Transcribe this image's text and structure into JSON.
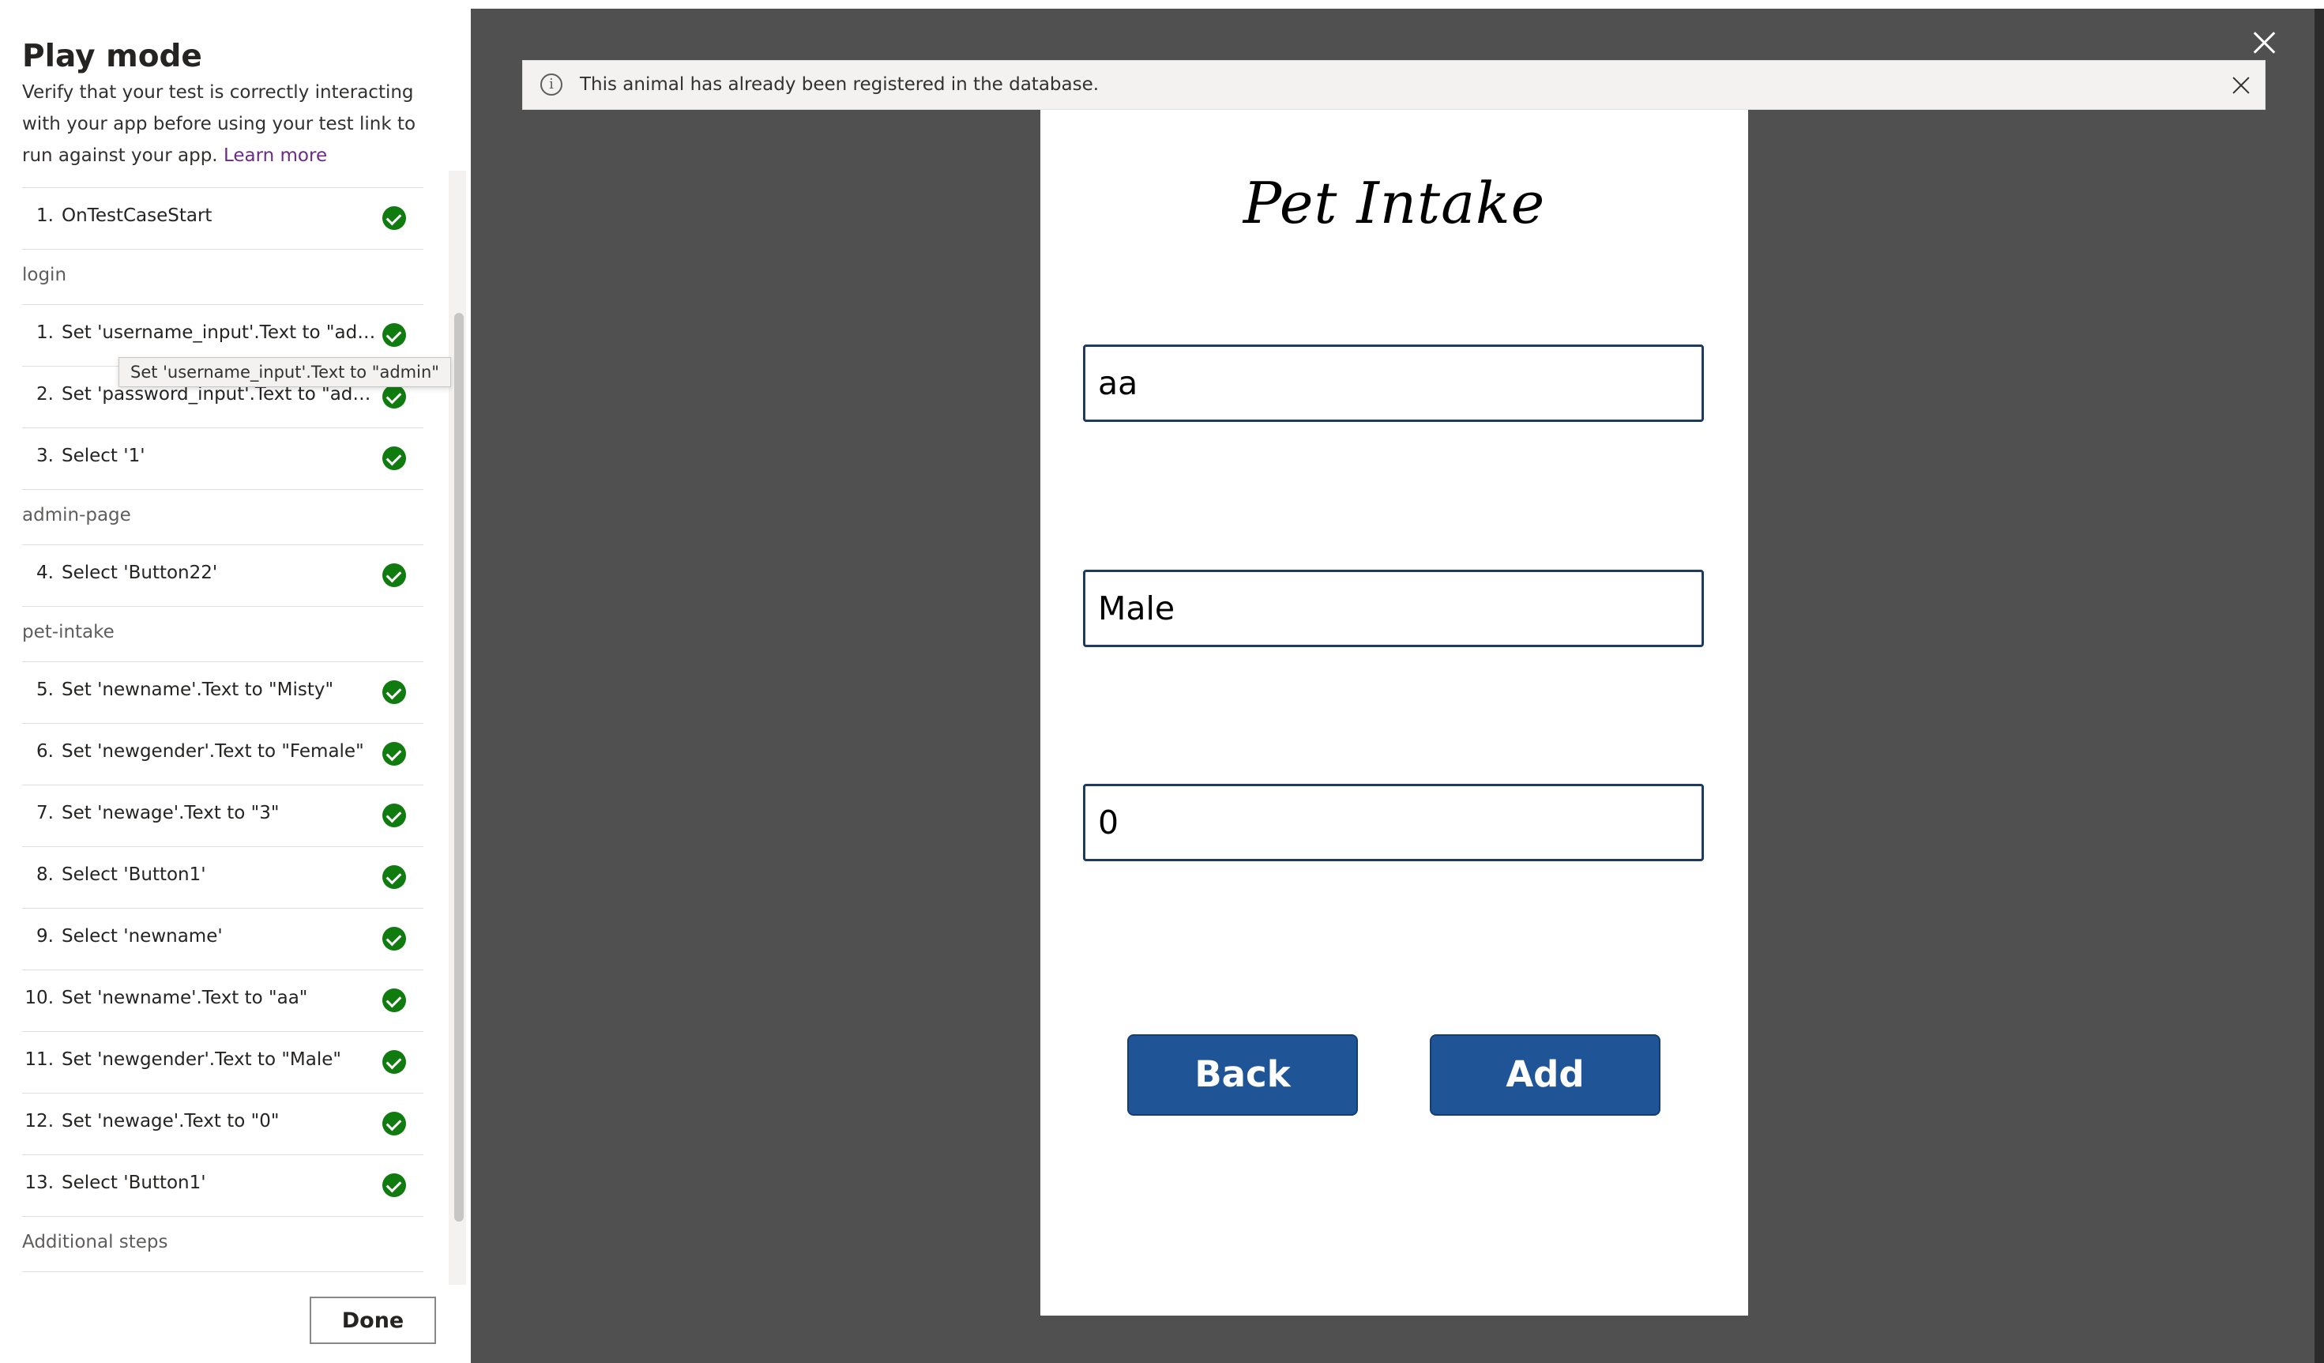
{
  "panel": {
    "title": "Play mode",
    "description": "Verify that your test is correctly interacting with your app before using your test link to run against your app.",
    "learn_more": "Learn more",
    "done_label": "Done"
  },
  "steps": {
    "setup": [
      {
        "num": "1.",
        "text": "OnTestCaseStart",
        "status": "passed"
      }
    ],
    "groups": [
      {
        "label": "login",
        "items": [
          {
            "num": "1.",
            "text": "Set 'username_input'.Text to \"adm...",
            "status": "passed"
          },
          {
            "num": "2.",
            "text": "Set 'password_input'.Text to \"admi...",
            "status": "passed"
          },
          {
            "num": "3.",
            "text": "Select '1'",
            "status": "passed"
          }
        ]
      },
      {
        "label": "admin-page",
        "items": [
          {
            "num": "4.",
            "text": "Select 'Button22'",
            "status": "passed"
          }
        ]
      },
      {
        "label": "pet-intake",
        "items": [
          {
            "num": "5.",
            "text": "Set 'newname'.Text to \"Misty\"",
            "status": "passed"
          },
          {
            "num": "6.",
            "text": "Set 'newgender'.Text to \"Female\"",
            "status": "passed"
          },
          {
            "num": "7.",
            "text": "Set 'newage'.Text to \"3\"",
            "status": "passed"
          },
          {
            "num": "8.",
            "text": "Select 'Button1'",
            "status": "passed"
          },
          {
            "num": "9.",
            "text": "Select 'newname'",
            "status": "passed"
          },
          {
            "num": "10.",
            "text": "Set 'newname'.Text to \"aa\"",
            "status": "passed"
          },
          {
            "num": "11.",
            "text": "Set 'newgender'.Text to \"Male\"",
            "status": "passed"
          },
          {
            "num": "12.",
            "text": "Set 'newage'.Text to \"0\"",
            "status": "passed"
          },
          {
            "num": "13.",
            "text": "Select 'Button1'",
            "status": "passed"
          }
        ]
      }
    ],
    "additional_label": "Additional steps"
  },
  "tooltip": "Set 'username_input'.Text to \"admin\"",
  "banner": {
    "icon": "info-icon",
    "message": "This animal has already been registered in the database."
  },
  "app": {
    "title": "Pet Intake",
    "name_value": "aa",
    "gender_value": "Male",
    "age_value": "0",
    "back_label": "Back",
    "add_label": "Add"
  },
  "colors": {
    "stage_bg": "#505050",
    "button_blue": "#1f5597",
    "check_green": "#107c10",
    "link_purple": "#6b2a86"
  }
}
